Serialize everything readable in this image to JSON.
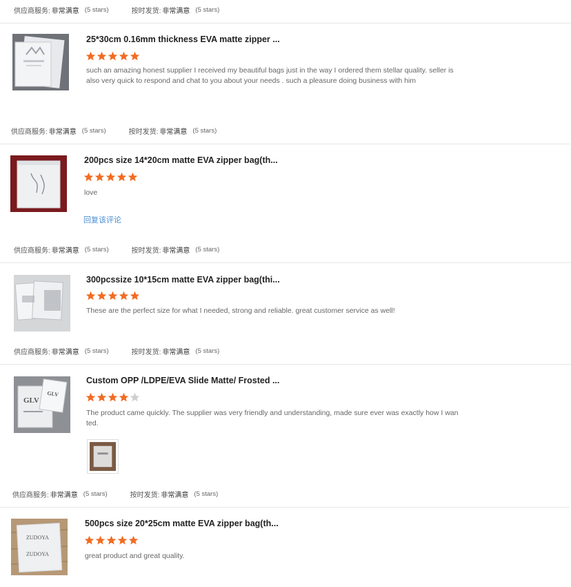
{
  "rating_labels": {
    "supplier_label": "供应商服务:",
    "supplier_value": "非常满意",
    "supplier_stars": "(5 stars)",
    "shipping_label": "按时发货:",
    "shipping_value": "非常满意",
    "shipping_stars": "(5 stars)"
  },
  "reviews": [
    {
      "title": "25*30cm 0.16mm thickness EVA matte zipper ...",
      "rating": 5,
      "comment": "such an amazing honest supplier I received my beautiful bags just in the way I ordered them stellar quality. seller is also very quick to respond and chat to you about your needs . such a pleasure doing business with him"
    },
    {
      "title": "200pcs size 14*20cm matte EVA zipper bag(th...",
      "rating": 5,
      "comment": "love",
      "reply_label": "回复该评论"
    },
    {
      "title": "300pcssize 10*15cm matte EVA zipper bag(thi...",
      "rating": 5,
      "comment": "These are the perfect size for what I needed, strong and reliable. great customer service as well!"
    },
    {
      "title": "Custom OPP /LDPE/EVA Slide Matte/ Frosted ...",
      "rating": 4,
      "comment": "The product came quickly. The supplier was very friendly and understanding, made sure ever was exactly how I wanted."
    },
    {
      "title": "500pcs size 20*25cm matte EVA zipper bag(th...",
      "rating": 5,
      "comment": "great product and great quality."
    }
  ],
  "thumb_text": {
    "glv": "GLV",
    "zudoya": "ZUDOYA"
  },
  "colors": {
    "star_filled": "#f26c22",
    "star_empty": "#cfcfcf",
    "reply_link": "#4a8fd4"
  }
}
